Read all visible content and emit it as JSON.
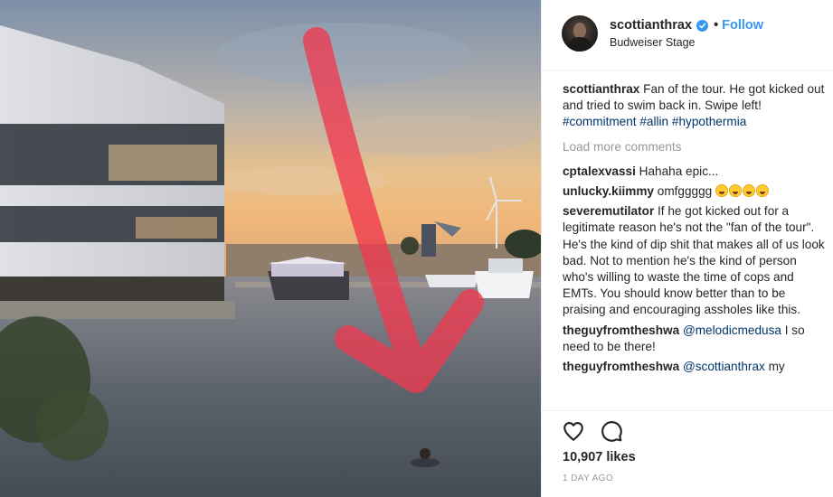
{
  "post": {
    "username": "scottianthrax",
    "verified_icon": "verified-badge-icon",
    "separator": "•",
    "follow_label": "Follow",
    "location": "Budweiser Stage"
  },
  "caption": {
    "user": "scottianthrax",
    "text": "Fan of the tour. He got kicked out and tried to swim back in. Swipe left!",
    "hashtags": [
      "#commitment",
      "#allin",
      "#hypothermia"
    ]
  },
  "load_more_label": "Load more comments",
  "comments": [
    {
      "user": "cptalexvassi",
      "text": "Hahaha epic..."
    },
    {
      "user": "unlucky.kiimmy",
      "text": "omfggggg",
      "emoji_count": 4
    },
    {
      "user": "severemutilator",
      "text": "If he got kicked out for a legitimate reason he's not the \"fan of the tour\". He's the kind of dip shit that makes all of us look bad. Not to mention he's the kind of person who's willing to waste the time of cops and EMTs. You should know better than to be praising and encouraging assholes like this."
    },
    {
      "user": "theguyfromtheshwa",
      "mention": "@melodicmedusa",
      "text": "I so need to be there!"
    },
    {
      "user": "theguyfromtheshwa",
      "mention": "@scottianthrax",
      "text": "my"
    }
  ],
  "actions": {
    "like_icon": "heart-icon",
    "comment_icon": "comment-bubble-icon"
  },
  "likes_label": "10,907 likes",
  "time_ago": "1 DAY AGO",
  "colors": {
    "link_blue": "#3897f0",
    "hashtag": "#003569",
    "muted": "#999999",
    "arrow": "#f0394f"
  }
}
